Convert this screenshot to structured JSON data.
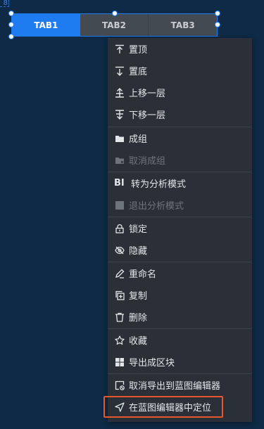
{
  "corner_marker": "8",
  "tabs": [
    {
      "label": "TAB1",
      "active": true
    },
    {
      "label": "TAB2",
      "active": false
    },
    {
      "label": "TAB3",
      "active": false
    }
  ],
  "menu": {
    "items": [
      {
        "label": "置顶",
        "icon": "bring-to-front-icon",
        "disabled": false
      },
      {
        "label": "置底",
        "icon": "send-to-back-icon",
        "disabled": false
      },
      {
        "label": "上移一层",
        "icon": "move-up-layer-icon",
        "disabled": false
      },
      {
        "label": "下移一层",
        "icon": "move-down-layer-icon",
        "disabled": false
      },
      {
        "label": "成组",
        "icon": "folder-icon",
        "disabled": false
      },
      {
        "label": "取消成组",
        "icon": "ungroup-folder-icon",
        "disabled": true
      },
      {
        "label": "转为分析模式",
        "icon": "bi-icon",
        "icon_text": "BI",
        "disabled": false
      },
      {
        "label": "退出分析模式",
        "icon": "square-icon",
        "disabled": true
      },
      {
        "label": "锁定",
        "icon": "lock-icon",
        "disabled": false
      },
      {
        "label": "隐藏",
        "icon": "eye-hidden-icon",
        "disabled": false
      },
      {
        "label": "重命名",
        "icon": "pencil-icon",
        "disabled": false
      },
      {
        "label": "复制",
        "icon": "copy-icon",
        "disabled": false
      },
      {
        "label": "删除",
        "icon": "trash-icon",
        "disabled": false
      },
      {
        "label": "收藏",
        "icon": "star-icon",
        "disabled": false
      },
      {
        "label": "导出成区块",
        "icon": "blocks-icon",
        "disabled": false
      },
      {
        "label": "取消导出到蓝图编辑器",
        "icon": "cancel-export-icon",
        "disabled": false
      },
      {
        "label": "在蓝图编辑器中定位",
        "icon": "locate-arrow-icon",
        "disabled": false,
        "highlighted": true
      }
    ]
  },
  "colors": {
    "background": "#0e2a46",
    "accent": "#1e7cf0",
    "menu_bg": "#2b3038",
    "highlight_border": "#e8572e"
  }
}
